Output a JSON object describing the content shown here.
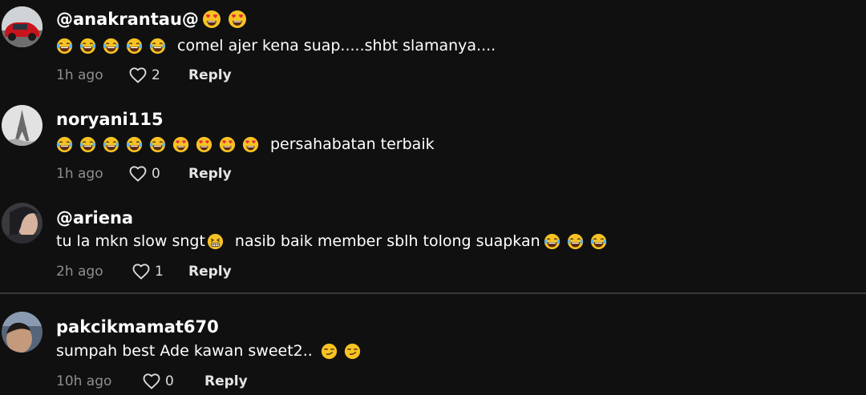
{
  "comments": [
    {
      "username": "@anakrantau@",
      "text": "comel ajer kena suap.....shbt slamanya....",
      "time": "1h ago",
      "likes": "2",
      "reply_label": "Reply"
    },
    {
      "username": "noryani115",
      "text": "persahabatan terbaik",
      "time": "1h ago",
      "likes": "0",
      "reply_label": "Reply"
    },
    {
      "username": "@ariena",
      "text_part1": "tu la mkn slow sngt",
      "text_part2": "nasib baik member sblh tolong suapkan",
      "time": "2h ago",
      "likes": "1",
      "reply_label": "Reply"
    },
    {
      "username": "pakcikmamat670",
      "text": "sumpah best Ade kawan sweet2..",
      "time": "10h ago",
      "likes": "0",
      "reply_label": "Reply"
    }
  ],
  "icons": {
    "like": "heart-outline-icon",
    "laugh": "face-with-tears-of-joy-icon",
    "heart_eyes": "smiling-face-with-heart-eyes-icon",
    "grimace": "grinning-squinting-face-icon",
    "smirk": "smirking-face-icon"
  },
  "colors": {
    "background": "#101010",
    "text": "#ffffff",
    "muted": "#8e8e8e",
    "emoji": "#f7c324"
  }
}
